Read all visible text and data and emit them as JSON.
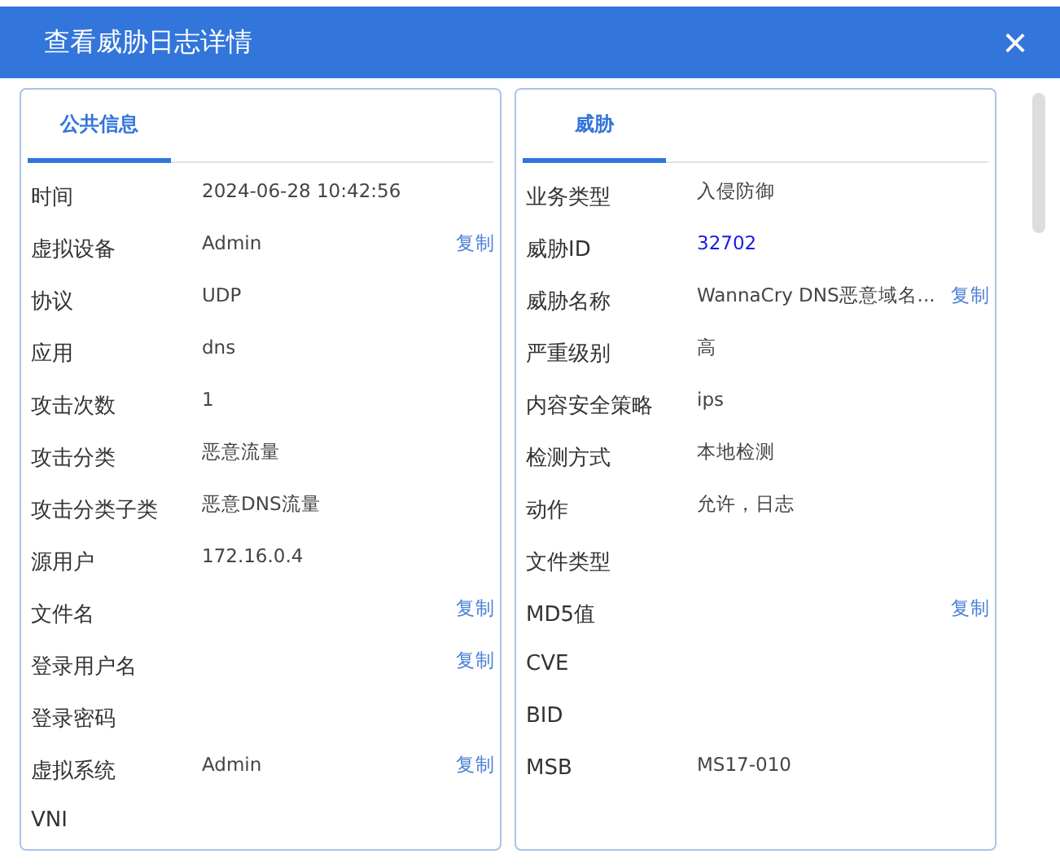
{
  "window": {
    "title": "查看威胁日志详情",
    "close": "×"
  },
  "panels": [
    {
      "tab": {
        "label": "公共信息",
        "selected": true
      },
      "rows": [
        {
          "label": "时间",
          "value": "2024-06-28 10:42:56",
          "kind": "plain"
        },
        {
          "label": "虚拟设备",
          "value": "Admin",
          "kind": "plain",
          "copy": "复制"
        },
        {
          "label": "协议",
          "value": "UDP",
          "kind": "plain"
        },
        {
          "label": "应用",
          "value": "dns",
          "kind": "plain"
        },
        {
          "label": "攻击次数",
          "value": "1",
          "kind": "plain"
        },
        {
          "label": "攻击分类",
          "value": "恶意流量",
          "kind": "plain"
        },
        {
          "label": "攻击分类子类",
          "value": "恶意DNS流量",
          "kind": "plain"
        },
        {
          "label": "源用户",
          "value": "172.16.0.4",
          "kind": "plain"
        },
        {
          "label": "文件名",
          "kind": "plain",
          "copy": "复制"
        },
        {
          "label": "登录用户名",
          "kind": "plain",
          "copy": "复制"
        },
        {
          "label": "登录密码",
          "kind": "plain"
        },
        {
          "label": "虚拟系统",
          "value": "Admin",
          "kind": "plain",
          "copy": "复制"
        },
        {
          "label": "VNI",
          "kind": "plain"
        }
      ]
    },
    {
      "tab": {
        "label": "威胁",
        "selected": true
      },
      "rows": [
        {
          "label": "业务类型",
          "value": "入侵防御",
          "kind": "plain"
        },
        {
          "label": "威胁ID",
          "value": "32702",
          "kind": "link"
        },
        {
          "label": "威胁名称",
          "value": "WannaCry DNS恶意域名...",
          "kind": "plain",
          "copy": "复制"
        },
        {
          "label": "严重级别",
          "value": "高",
          "kind": "plain"
        },
        {
          "label": "内容安全策略",
          "value": "ips",
          "kind": "plain"
        },
        {
          "label": "检测方式",
          "value": "本地检测",
          "kind": "plain"
        },
        {
          "label": "动作",
          "value": "允许，日志",
          "kind": "plain"
        },
        {
          "label": "文件类型",
          "kind": "plain"
        },
        {
          "label": "MD5值",
          "kind": "plain",
          "copy": "复制"
        },
        {
          "label": "CVE",
          "kind": "plain"
        },
        {
          "label": "BID",
          "kind": "plain"
        },
        {
          "label": "MSB",
          "value": "MS17-010",
          "kind": "plain"
        }
      ]
    }
  ]
}
